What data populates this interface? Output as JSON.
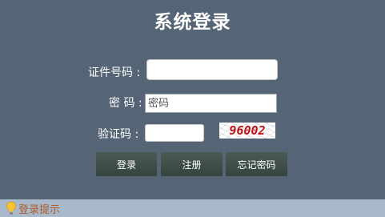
{
  "header": {
    "title": "系统登录"
  },
  "form": {
    "id_label": "证件号码 :",
    "id_value": "",
    "id_placeholder": "",
    "password_label": "密 码 :",
    "password_placeholder": "密码",
    "captcha_label": "验证码 :",
    "captcha_value": "",
    "captcha_image_text": "96002"
  },
  "buttons": {
    "login": "登录",
    "register": "注册",
    "forgot": "忘记密码"
  },
  "footer": {
    "icon": "lightbulb-icon",
    "text": "登录提示"
  },
  "colors": {
    "background": "#566575",
    "button": "#3f4d48",
    "footer": "#a7b9cb",
    "captcha_text": "#c01414",
    "footer_text": "#b05a2a"
  }
}
